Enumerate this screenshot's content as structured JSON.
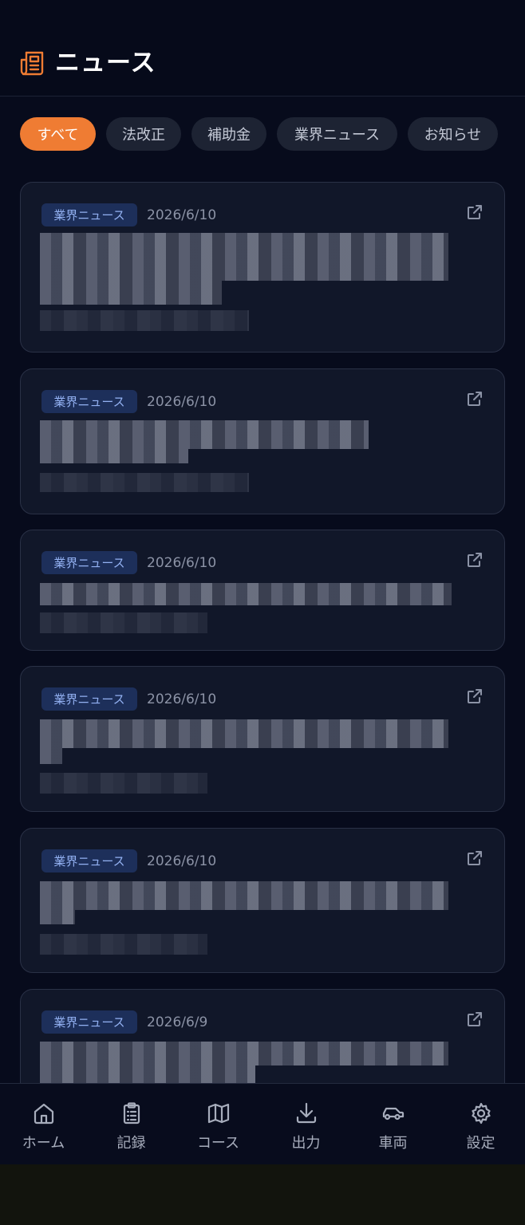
{
  "header": {
    "title": "ニュース",
    "icon": "newspaper-icon",
    "accent": "#ef7c33"
  },
  "filters": [
    {
      "label": "すべて",
      "active": true
    },
    {
      "label": "法改正",
      "active": false
    },
    {
      "label": "補助金",
      "active": false
    },
    {
      "label": "業界ニュース",
      "active": false
    },
    {
      "label": "お知らせ",
      "active": false
    }
  ],
  "news": [
    {
      "tag": "業界ニュース",
      "date": "2026/6/10"
    },
    {
      "tag": "業界ニュース",
      "date": "2026/6/10"
    },
    {
      "tag": "業界ニュース",
      "date": "2026/6/10"
    },
    {
      "tag": "業界ニュース",
      "date": "2026/6/10"
    },
    {
      "tag": "業界ニュース",
      "date": "2026/6/10"
    },
    {
      "tag": "業界ニュース",
      "date": "2026/6/9"
    }
  ],
  "nav": [
    {
      "label": "ホーム",
      "icon": "home-icon"
    },
    {
      "label": "記録",
      "icon": "clipboard-icon"
    },
    {
      "label": "コース",
      "icon": "map-icon"
    },
    {
      "label": "出力",
      "icon": "download-icon"
    },
    {
      "label": "車両",
      "icon": "car-icon"
    },
    {
      "label": "設定",
      "icon": "gear-icon"
    }
  ]
}
